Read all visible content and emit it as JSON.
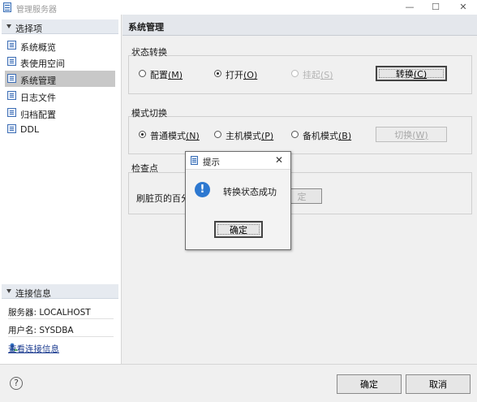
{
  "window": {
    "title": "管理服务器",
    "min": "—",
    "max": "☐",
    "close": "✕"
  },
  "sidebar": {
    "options_header": "选择项",
    "items": [
      {
        "label": "系统概览",
        "selected": false
      },
      {
        "label": "表使用空间",
        "selected": false
      },
      {
        "label": "系统管理",
        "selected": true
      },
      {
        "label": "日志文件",
        "selected": false
      },
      {
        "label": "归档配置",
        "selected": false
      },
      {
        "label": "DDL",
        "selected": false
      }
    ],
    "conn_header": "连接信息",
    "server": "服务器: LOCALHOST",
    "user": "用户名: SYSDBA",
    "view_conn_link": "查看连接信息"
  },
  "main": {
    "header": "系统管理",
    "state_group": {
      "title": "状态转换",
      "radio_config": {
        "text": "配置",
        "mnemonic": "(M)"
      },
      "radio_open": {
        "text": "打开",
        "mnemonic": "(O)"
      },
      "radio_suspend": {
        "text": "挂起",
        "mnemonic": "(S)"
      },
      "convert_button": {
        "text": "转换",
        "mnemonic": "(C)"
      }
    },
    "mode_group": {
      "title": "模式切换",
      "radio_normal": {
        "text": "普通模式",
        "mnemonic": "(N)"
      },
      "radio_primary": {
        "text": "主机模式",
        "mnemonic": "(P)"
      },
      "radio_standby": {
        "text": "备机模式",
        "mnemonic": "(B)"
      },
      "switch_button": {
        "text": "切换",
        "mnemonic": "(W)"
      }
    },
    "checkpoint_group": {
      "title": "检查点",
      "label": "刷脏页的百分比",
      "button_tail": "定"
    }
  },
  "dialog": {
    "title": "提示",
    "message": "转换状态成功",
    "ok": "确定",
    "info_glyph": "!",
    "close": "✕"
  },
  "footer": {
    "ok": "确定",
    "cancel": "取消",
    "help": "?"
  }
}
